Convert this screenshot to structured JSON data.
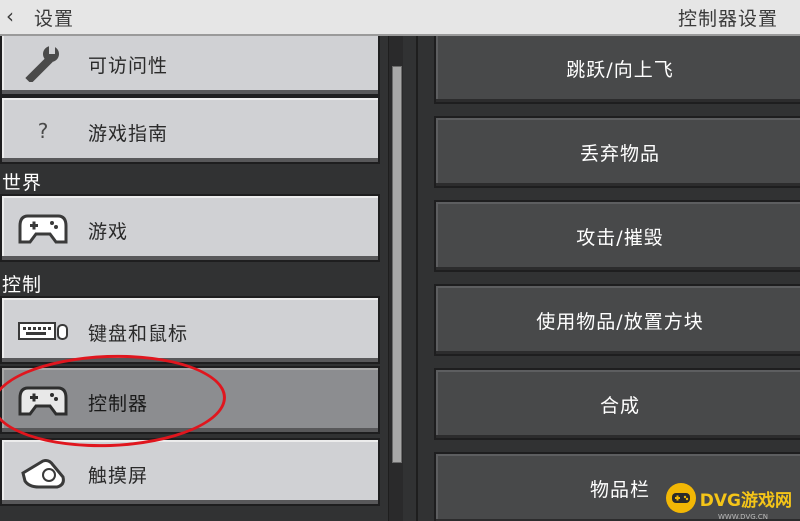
{
  "header": {
    "back_icon": "chevron-left-icon",
    "back_label": "设置",
    "title": "控制器设置"
  },
  "sidebar": {
    "items": [
      {
        "label": "可访问性",
        "icon": "wrench-icon"
      },
      {
        "label": "游戏指南",
        "icon": "question-icon"
      },
      {
        "section": "世界"
      },
      {
        "label": "游戏",
        "icon": "gamepad-icon"
      },
      {
        "section": "控制"
      },
      {
        "label": "键盘和鼠标",
        "icon": "keyboard-mouse-icon"
      },
      {
        "label": "控制器",
        "icon": "gamepad-icon",
        "selected": true
      },
      {
        "label": "触摸屏",
        "icon": "touch-hand-icon"
      }
    ],
    "question_glyph": "?"
  },
  "bindings": [
    {
      "label": "跳跃/向上飞"
    },
    {
      "label": "丢弃物品"
    },
    {
      "label": "攻击/摧毁"
    },
    {
      "label": "使用物品/放置方块"
    },
    {
      "label": "合成"
    },
    {
      "label": "物品栏"
    }
  ],
  "watermark": {
    "text": "DVG游戏网",
    "sub": "WWW.DVG.CN"
  },
  "colors": {
    "selected_bg": "#8c8d90",
    "item_bg": "#d0d1d4",
    "annotation_red": "#e0161e",
    "watermark_gold": "#f5c518"
  }
}
